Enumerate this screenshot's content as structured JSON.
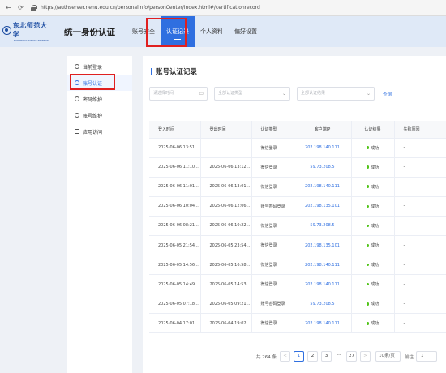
{
  "browser": {
    "url": "https://authserver.nenu.edu.cn/personalInfo/personCenter/index.html#/certificationrecord"
  },
  "header": {
    "logo_text": "东北师范大学",
    "logo_subtext": "NORTHEAST NORMAL UNIVERSITY",
    "brand": "统一身份认证",
    "nav": [
      {
        "label": "账号安全"
      },
      {
        "label": "认证记录"
      },
      {
        "label": "个人资料"
      },
      {
        "label": "偏好设置"
      }
    ],
    "active_nav": "认证记录"
  },
  "sidebar": {
    "items": [
      {
        "label": "当前登录",
        "icon": "login-icon"
      },
      {
        "label": "账号认证",
        "icon": "shield-icon"
      },
      {
        "label": "密码维护",
        "icon": "lock-icon"
      },
      {
        "label": "账号维护",
        "icon": "user-icon"
      },
      {
        "label": "应用访问",
        "icon": "apps-icon"
      }
    ],
    "active": "账号认证"
  },
  "main": {
    "title": "账号认证记录",
    "filters": {
      "date_placeholder": "请选择时间",
      "type_placeholder": "全部认证类型",
      "result_placeholder": "全部认证结果",
      "query_label": "查询"
    },
    "table": {
      "headers": [
        "登入时间",
        "登出时间",
        "认证类型",
        "客户端IP",
        "认证结果",
        "失败原因"
      ],
      "rows": [
        [
          "2025-06-06 13:51...",
          "",
          "微信登录",
          "202.198.140.111",
          "成功",
          "-"
        ],
        [
          "2025-06-06 11:10...",
          "2025-06-06 13:12...",
          "微信登录",
          "59.73.208.5",
          "成功",
          "-"
        ],
        [
          "2025-06-06 11:01...",
          "2025-06-06 13:01...",
          "微信登录",
          "202.198.140.111",
          "成功",
          "-"
        ],
        [
          "2025-06-06 10:04...",
          "2025-06-06 12:06...",
          "账号密码登录",
          "202.198.135.101",
          "成功",
          "-"
        ],
        [
          "2025-06-06 08:21...",
          "2025-06-06 10:22...",
          "微信登录",
          "59.73.208.5",
          "成功",
          "-"
        ],
        [
          "2025-06-05 21:54...",
          "2025-06-05 23:54...",
          "微信登录",
          "202.198.135.101",
          "成功",
          "-"
        ],
        [
          "2025-06-05 14:56...",
          "2025-06-05 16:58...",
          "微信登录",
          "202.198.140.111",
          "成功",
          "-"
        ],
        [
          "2025-06-05 14:49...",
          "2025-06-05 14:53...",
          "微信登录",
          "202.198.140.111",
          "成功",
          "-"
        ],
        [
          "2025-06-05 07:18...",
          "2025-06-05 09:21...",
          "账号密码登录",
          "59.73.208.5",
          "成功",
          "-"
        ],
        [
          "2025-06-04 17:01...",
          "2025-06-04 19:02...",
          "微信登录",
          "202.198.140.111",
          "成功",
          "-"
        ]
      ]
    },
    "pagination": {
      "total": "共 264 条",
      "prev": "<",
      "pages": [
        "1",
        "2",
        "3",
        "···",
        "27"
      ],
      "current": "1",
      "next": ">",
      "page_size": "10条/页",
      "goto_label": "前往",
      "goto_value": "1"
    }
  },
  "colors": {
    "accent": "#2f6fe0",
    "highlight_box": "#e02020",
    "success": "#52c41a",
    "header_bg": "#dfe9f7"
  }
}
